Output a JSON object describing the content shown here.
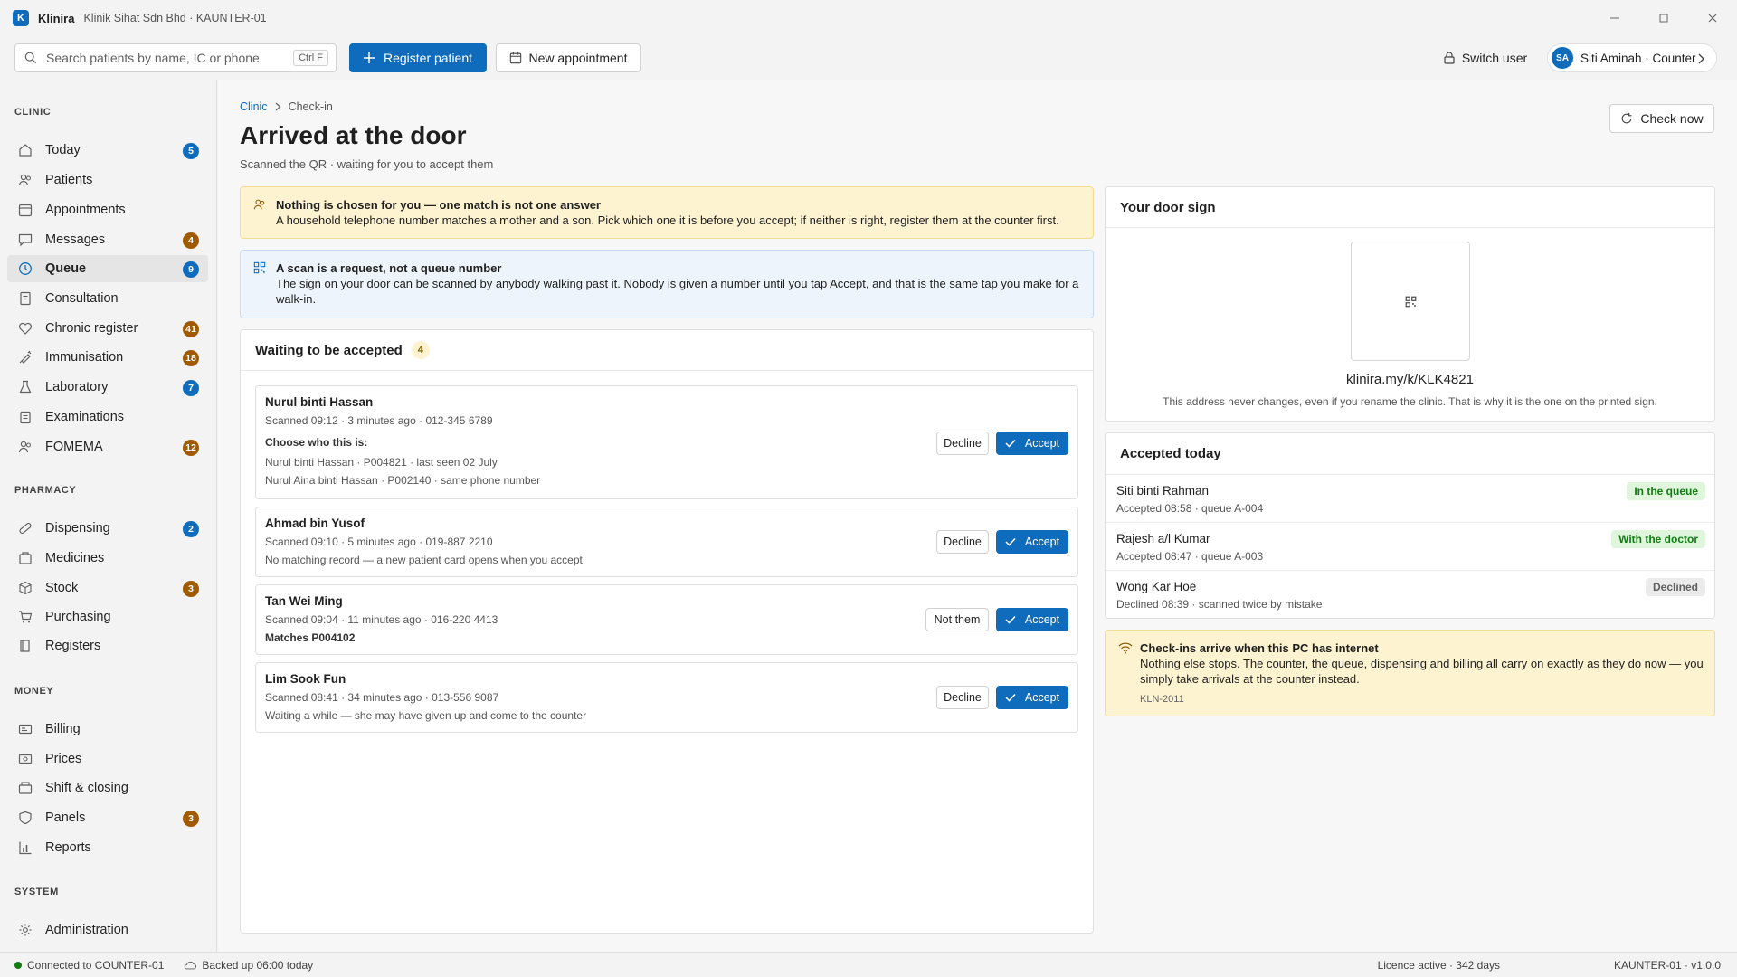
{
  "window": {
    "app_name": "Klinira",
    "logo_letter": "K",
    "subtitle": "Klinik Sihat Sdn Bhd · KAUNTER-01"
  },
  "toolbar": {
    "search_placeholder": "Search patients by name, IC or phone",
    "search_shortcut": "Ctrl F",
    "register_label": "Register patient",
    "appointment_label": "New appointment",
    "switch_user_label": "Switch user",
    "user_initials": "SA",
    "user_label": "Siti Aminah · Counter"
  },
  "sidebar": {
    "clinic_title": "CLINIC",
    "clinic_items": [
      {
        "label": "Today",
        "badge": "5"
      },
      {
        "label": "Patients",
        "badge": ""
      },
      {
        "label": "Appointments",
        "badge": ""
      },
      {
        "label": "Messages",
        "badge": "4"
      },
      {
        "label": "Queue",
        "badge": "9"
      },
      {
        "label": "Consultation",
        "badge": ""
      },
      {
        "label": "Chronic register",
        "badge": "41"
      },
      {
        "label": "Immunisation",
        "badge": "18"
      },
      {
        "label": "Laboratory",
        "badge": "7"
      },
      {
        "label": "Examinations",
        "badge": ""
      },
      {
        "label": "FOMEMA",
        "badge": "12"
      }
    ],
    "pharmacy_title": "PHARMACY",
    "pharmacy_items": [
      {
        "label": "Dispensing",
        "badge": "2"
      },
      {
        "label": "Medicines",
        "badge": ""
      },
      {
        "label": "Stock",
        "badge": "3"
      },
      {
        "label": "Purchasing",
        "badge": ""
      },
      {
        "label": "Registers",
        "badge": ""
      }
    ],
    "money_title": "MONEY",
    "money_items": [
      {
        "label": "Billing",
        "badge": ""
      },
      {
        "label": "Prices",
        "badge": ""
      },
      {
        "label": "Shift & closing",
        "badge": ""
      },
      {
        "label": "Panels",
        "badge": "3"
      },
      {
        "label": "Reports",
        "badge": ""
      }
    ],
    "system_title": "SYSTEM",
    "system_items": [
      {
        "label": "Administration",
        "badge": ""
      }
    ]
  },
  "breadcrumb": {
    "root": "Clinic",
    "current": "Check-in"
  },
  "page": {
    "title": "Arrived at the door",
    "subtitle": "Scanned the QR · waiting for you to accept them",
    "check_now": "Check now"
  },
  "alerts": {
    "match": {
      "title": "Nothing is chosen for you — one match is not one answer",
      "body": "A household telephone number matches a mother and a son. Pick which one it is before you accept; if neither is right, register them at the counter first."
    },
    "scan": {
      "title": "A scan is a request, not a queue number",
      "body": "The sign on your door can be scanned by anybody walking past it. Nobody is given a number until you tap Accept, and that is the same tap you make for a walk-in."
    }
  },
  "waiting": {
    "title": "Waiting to be accepted",
    "count": "4",
    "accept_label": "Accept",
    "cards": [
      {
        "name": "Nurul binti Hassan",
        "meta": "Scanned 09:12 · 3 minutes ago · 012-345 6789",
        "choose": "Choose who this is:",
        "option1": "Nurul binti Hassan · P004821 · last seen 02 July",
        "option2": "Nurul Aina binti Hassan · P002140 · same phone number",
        "decline": "Decline"
      },
      {
        "name": "Ahmad bin Yusof",
        "meta": "Scanned 09:10 · 5 minutes ago · 019-887 2210",
        "note": "No matching record — a new patient card opens when you accept",
        "decline": "Decline"
      },
      {
        "name": "Tan Wei Ming",
        "meta": "Scanned 09:04 · 11 minutes ago · 016-220 4413",
        "note": "Matches P004102",
        "decline": "Not them"
      },
      {
        "name": "Lim Sook Fun",
        "meta": "Scanned 08:41 · 34 minutes ago · 013-556 9087",
        "note": "Waiting a while — she may have given up and come to the counter",
        "decline": "Decline"
      }
    ]
  },
  "door_sign": {
    "title": "Your door sign",
    "url": "klinira.my/k/KLK4821",
    "note": "This address never changes, even if you rename the clinic. That is why it is the one on the printed sign."
  },
  "accepted": {
    "title": "Accepted today",
    "items": [
      {
        "name": "Siti binti Rahman",
        "meta": "Accepted 08:58 · queue A-004",
        "status": "In the queue",
        "status_color": "#107c10",
        "status_bg": "#dff6dd"
      },
      {
        "name": "Rajesh a/l Kumar",
        "meta": "Accepted 08:47 · queue A-003",
        "status": "With the doctor",
        "status_color": "#107c10",
        "status_bg": "#dff6dd"
      },
      {
        "name": "Wong Kar Hoe",
        "meta": "Declined 08:39 · scanned twice by mistake",
        "status": "Declined",
        "status_color": "#616161",
        "status_bg": "#ebebeb"
      }
    ]
  },
  "offline_note": {
    "title": "Check-ins arrive when this PC has internet",
    "body": "Nothing else stops. The counter, the queue, dispensing and billing all carry on exactly as they do now — you simply take arrivals at the counter instead.",
    "code": "KLN-2011"
  },
  "statusbar": {
    "connection": "Connected to COUNTER-01",
    "backup": "Backed up 06:00 today",
    "licence": "Licence active · 342 days",
    "version": "KAUNTER-01 · v1.0.0"
  },
  "colors": {
    "accent": "#0f6cbd",
    "warning_bg": "#fdf3d0",
    "info_bg": "#eef4fb",
    "badge_amber": "#a05a00",
    "success": "#107c10"
  }
}
